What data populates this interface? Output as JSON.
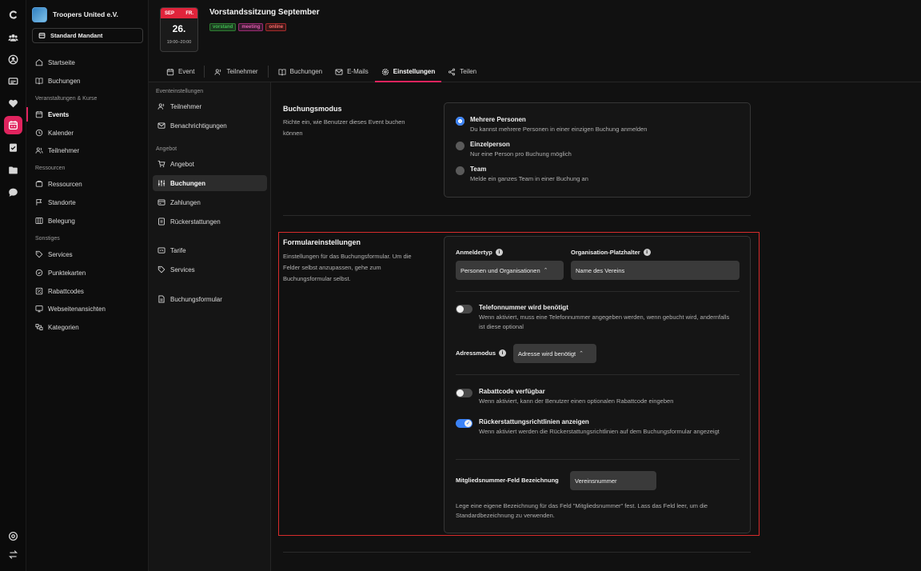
{
  "org": {
    "name": "Troopers United e.V.",
    "mandant": "Standard Mandant"
  },
  "nav": {
    "startseite": "Startseite",
    "buchungen": "Buchungen",
    "section_veranstaltungen": "Veranstaltungen & Kurse",
    "events": "Events",
    "kalender": "Kalender",
    "teilnehmer": "Teilnehmer",
    "section_ressourcen": "Ressourcen",
    "ressourcen": "Ressourcen",
    "standorte": "Standorte",
    "belegung": "Belegung",
    "section_sonstiges": "Sonstiges",
    "services": "Services",
    "punktekarten": "Punktekarten",
    "rabattcodes": "Rabattcodes",
    "webseitenansichten": "Webseitenansichten",
    "kategorien": "Kategorien"
  },
  "event": {
    "month": "SEP",
    "weekday": "FR.",
    "day": "26.",
    "time": "19:00–20:00",
    "title": "Vorstandssitzung September",
    "tags": [
      {
        "label": "vorstand",
        "color": "#3fb950",
        "bg": "#1c3a1f"
      },
      {
        "label": "meeting",
        "color": "#e35bb0",
        "bg": "#3a1a30"
      },
      {
        "label": "online",
        "color": "#ff6b6b",
        "bg": "#3a1717"
      }
    ]
  },
  "tabs": {
    "event": "Event",
    "teilnehmer": "Teilnehmer",
    "buchungen": "Buchungen",
    "emails": "E-Mails",
    "einstellungen": "Einstellungen",
    "teilen": "Teilen"
  },
  "subnav": {
    "section_event": "Eventeinstellungen",
    "teilnehmer": "Teilnehmer",
    "benachrichtigungen": "Benachrichtigungen",
    "section_angebot": "Angebot",
    "angebot": "Angebot",
    "buchungen": "Buchungen",
    "zahlungen": "Zahlungen",
    "rueckerstattungen": "Rückerstattungen",
    "tarife": "Tarife",
    "services": "Services",
    "buchungsformular": "Buchungsformular"
  },
  "buchungsmodus": {
    "title": "Buchungsmodus",
    "description": "Richte ein, wie Benutzer dieses Event buchen können",
    "options": [
      {
        "label": "Mehrere Personen",
        "desc": "Du kannst mehrere Personen in einer einzigen Buchung anmelden",
        "selected": true
      },
      {
        "label": "Einzelperson",
        "desc": "Nur eine Person pro Buchung möglich",
        "selected": false
      },
      {
        "label": "Team",
        "desc": "Melde ein ganzes Team in einer Buchung an",
        "selected": false
      }
    ]
  },
  "formular": {
    "title": "Formulareinstellungen",
    "description": "Einstellungen für das Buchungsformular. Um die Felder selbst anzupassen, gehe zum Buchungsformular selbst.",
    "anmeldertyp_label": "Anmeldertyp",
    "anmeldertyp_value": "Personen und Organisationen",
    "platzhalter_label": "Organisation-Platzhalter",
    "platzhalter_value": "Name des Vereins",
    "telefon_label": "Telefonnummer wird benötigt",
    "telefon_desc": "Wenn aktiviert, muss eine Telefonnummer angegeben werden, wenn gebucht wird, andernfalls ist diese optional",
    "telefon_on": false,
    "adressmodus_label": "Adressmodus",
    "adressmodus_value": "Adresse wird benötigt",
    "rabatt_label": "Rabattcode verfügbar",
    "rabatt_desc": "Wenn aktiviert, kann der Benutzer einen optionalen Rabattcode eingeben",
    "rabatt_on": false,
    "rueck_label": "Rückerstattungsrichtlinien anzeigen",
    "rueck_desc": "Wenn aktiviert werden die Rückerstattungsrichtlinien auf dem Buchungsformular angezeigt",
    "rueck_on": true,
    "mitglied_label": "Mitgliedsnummer-Feld Bezeichnung",
    "mitglied_value": "Vereinsnummer",
    "mitglied_hint": "Lege eine eigene Bezeichnung für das Feld \"Mitgliedsnummer\" fest. Lass das Feld leer, um die Standardbezeichnung zu verwenden."
  },
  "colors": {
    "accent": "#e0245e",
    "toggle_on": "#3b82f6",
    "highlight": "#d72b2b"
  }
}
